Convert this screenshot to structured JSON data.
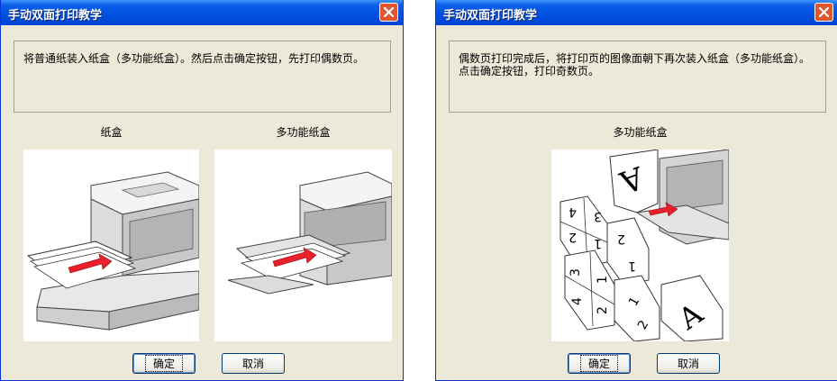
{
  "left_dialog": {
    "title": "手动双面打印教学",
    "message": "将普通纸装入纸盒（多功能纸盒）。然后点击确定按钮，先打印偶数页。",
    "caption_tray": "纸盒",
    "caption_mp_tray": "多功能纸盒",
    "ok_label": "确定",
    "cancel_label": "取消"
  },
  "right_dialog": {
    "title": "手动双面打印教学",
    "message": "偶数页打印完成后，将打印页的图像面朝下再次装入纸盒（多功能纸盒）。点击确定按钮，打印奇数页。",
    "caption_mp_tray": "多功能纸盒",
    "ok_label": "确定",
    "cancel_label": "取消",
    "page_numbers": [
      "4",
      "3",
      "2",
      "1",
      "2",
      "1",
      "3",
      "1",
      "4",
      "2",
      "1",
      "2"
    ],
    "page_letter": "A"
  },
  "colors": {
    "titlebar": "#0054e3",
    "dialog_bg": "#ece9d8",
    "close_button": "#e0562f",
    "arrow": "#e8202a"
  },
  "icons": {
    "close": "close-x-icon"
  }
}
